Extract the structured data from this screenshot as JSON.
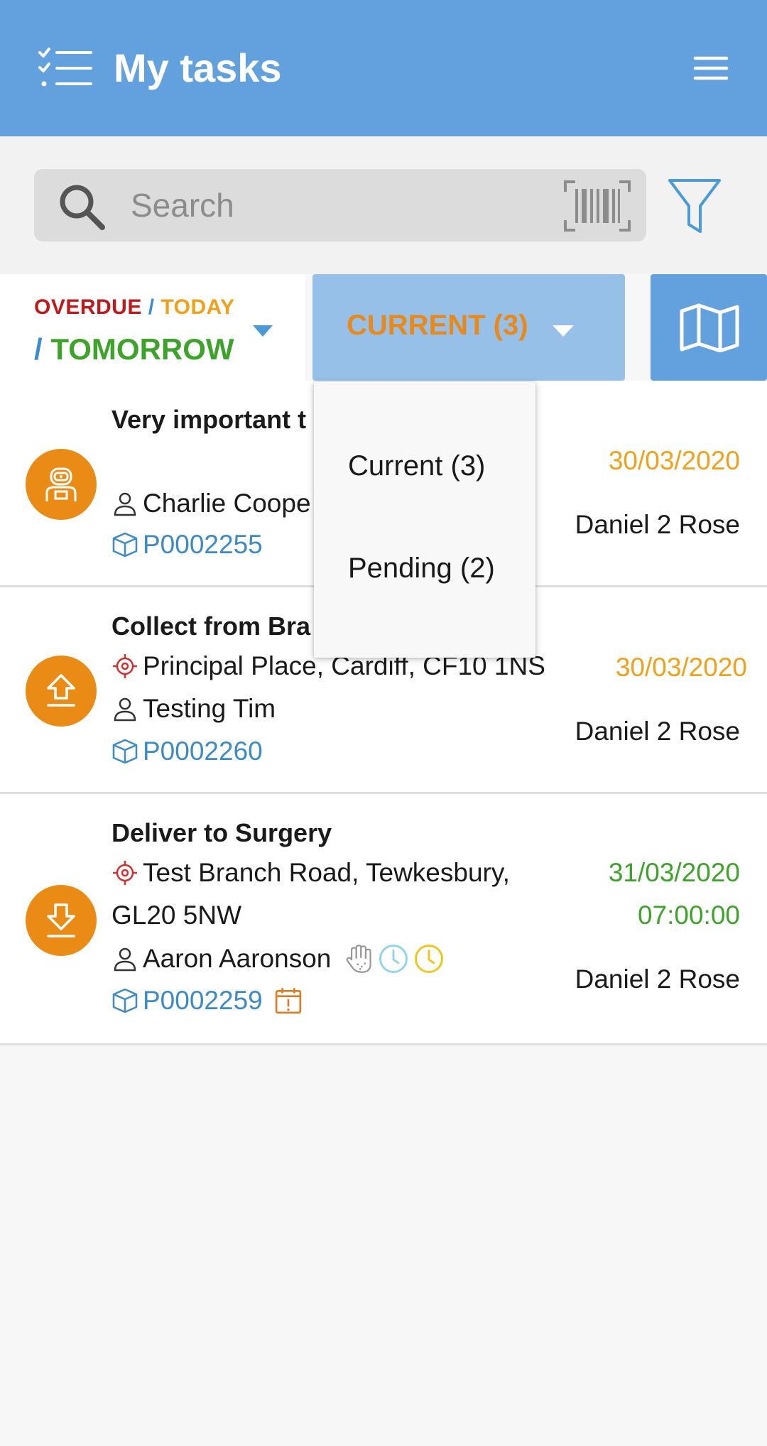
{
  "header": {
    "title": "My tasks",
    "left_icon": "checklist-icon",
    "right_icon": "hamburger-menu-icon",
    "bg_color": "#62a1dd"
  },
  "search": {
    "placeholder": "Search",
    "search_icon": "search-icon",
    "barcode_icon": "barcode-scan-icon",
    "filter_icon": "filter-icon"
  },
  "date_filter": {
    "overdue": "OVERDUE",
    "slash1": " / ",
    "today": "TODAY",
    "slash2": "/ ",
    "tomorrow": "TOMORROW",
    "colors": {
      "overdue": "#c0181b",
      "today": "#f0a11a",
      "tomorrow": "#3da32a",
      "slash": "#3d8bd1"
    }
  },
  "status_tab": {
    "label": "CURRENT (3)",
    "color": "#e8891a"
  },
  "map_tab": {
    "icon": "map-icon"
  },
  "dropdown": {
    "options": [
      "Current (3)",
      "Pending (2)"
    ]
  },
  "tasks": [
    {
      "icon": "robot-icon",
      "title": "Very important t",
      "address": "",
      "contact": "Charlie Coope",
      "ref": "P0002255",
      "date": "30/03/2020",
      "date_color": "#f0a11a",
      "driver": "Daniel 2 Rose"
    },
    {
      "icon": "upload-icon",
      "title": "Collect from Bra",
      "address": "Principal Place, Cardiff, CF10 1NS",
      "contact": "Testing Tim",
      "ref": "P0002260",
      "date": "30/03/2020",
      "date_color": "#f0a11a",
      "driver": "Daniel 2 Rose"
    },
    {
      "icon": "download-icon",
      "title": "Deliver to Surgery",
      "address_line1": "Test Branch Road, Tewkesbury,",
      "address_line2": "GL20 5NW",
      "contact": "Aaron Aaronson",
      "ref": "P0002259",
      "date": "31/03/2020",
      "time": "07:00:00",
      "date_color": "#3da32a",
      "driver": "Daniel 2 Rose",
      "badges": [
        "hand-icon",
        "clock-blue-icon",
        "clock-yellow-icon",
        "calendar-alert-icon"
      ]
    }
  ]
}
